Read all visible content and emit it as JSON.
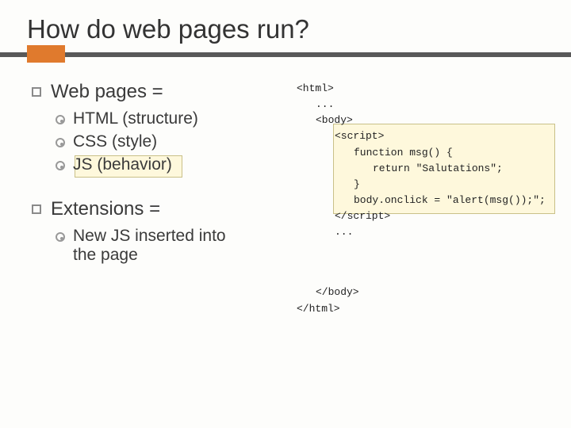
{
  "title": "How do web pages run?",
  "bullets": {
    "webpages": {
      "label": "Web pages =",
      "items": [
        "HTML (structure)",
        "CSS (style)",
        "JS (behavior)"
      ]
    },
    "extensions": {
      "label": "Extensions =",
      "items": [
        "New JS inserted into the page"
      ]
    }
  },
  "code": {
    "l1": "<html>",
    "l2": "...",
    "l3": "<body>",
    "l4": "<script>",
    "l5": "function msg() {",
    "l6": "return \"Salutations\";",
    "l7": "}",
    "l8": "body.onclick = \"alert(msg());\";",
    "l9": "</script>",
    "l10": "...",
    "l11": "</body>",
    "l12": "</html>"
  }
}
